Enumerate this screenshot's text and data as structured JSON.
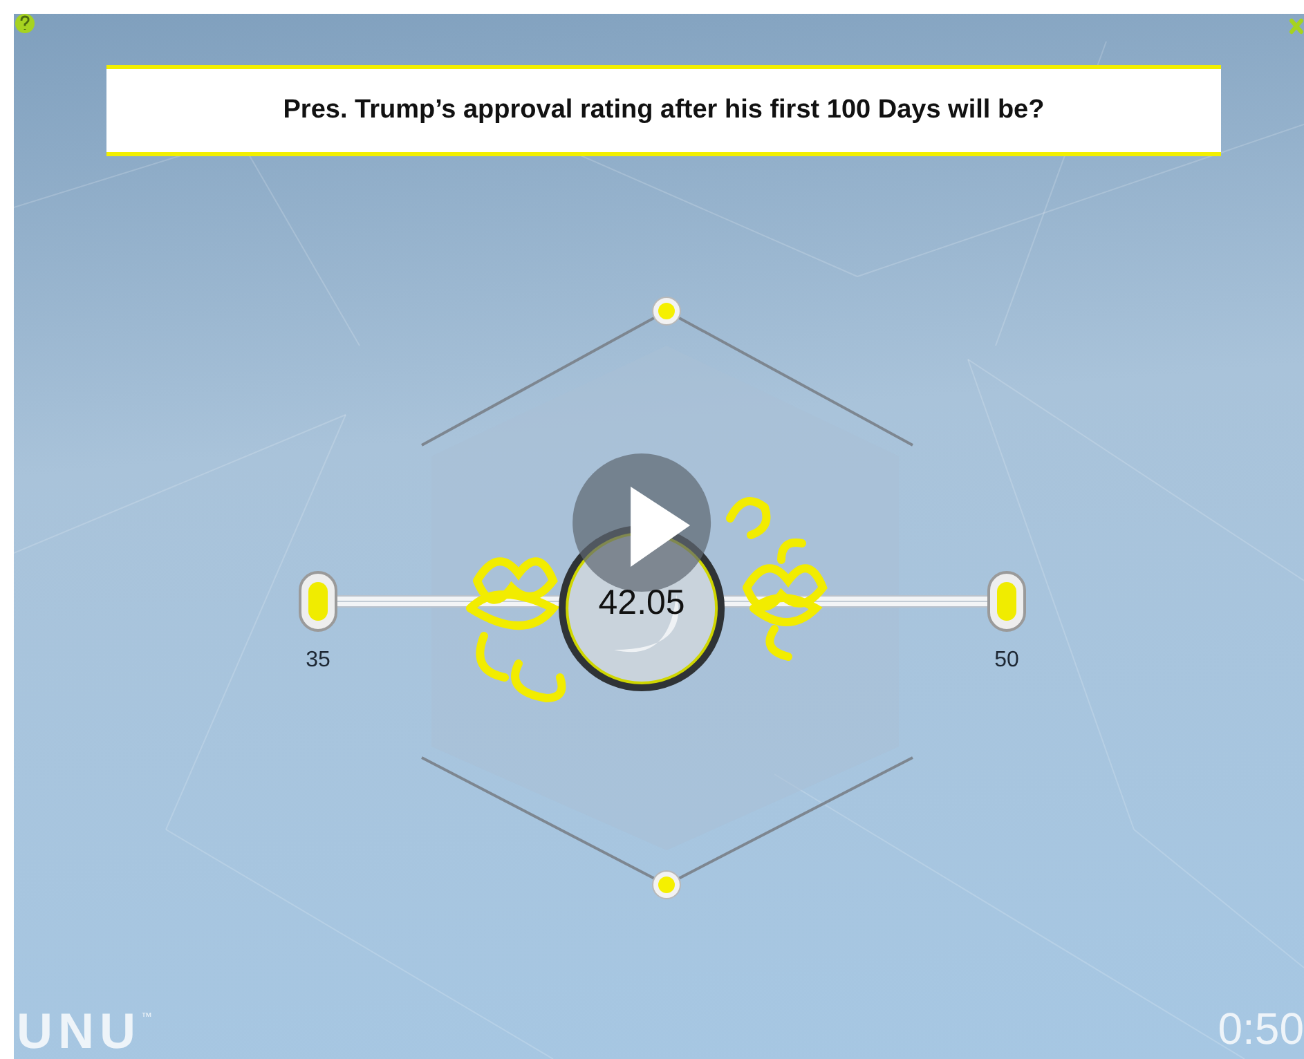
{
  "question": "Pres. Trump’s approval rating after his first 100 Days will be?",
  "slider": {
    "min_label": "35",
    "max_label": "50",
    "value": "42.05",
    "level": 0.47
  },
  "logo": {
    "text": "UNU",
    "mark": "™"
  },
  "timer": "0:50"
}
